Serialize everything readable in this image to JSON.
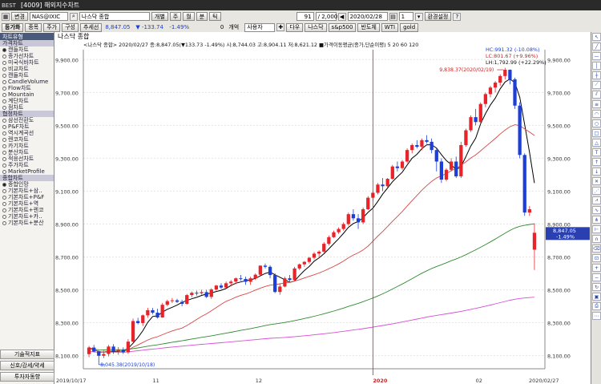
{
  "window": {
    "title": "[4009] 해외지수차트",
    "logo": "BEST"
  },
  "toolbar1": {
    "type": "변경",
    "code": "NAS@IXIC",
    "name": "나스닥 종합",
    "period": "개별",
    "tabs": [
      "주",
      "월",
      "분",
      "틱"
    ],
    "count_value": "91",
    "count_total": "2,000",
    "date": "2020/02/28",
    "lock": "1",
    "env": "환경설정"
  },
  "toolbar2": {
    "mode": "등가화",
    "buttons": [
      "종목",
      "주가",
      "구성",
      "추세선"
    ],
    "price": "8,847.05",
    "change": "▼ -133.74",
    "rate": "-1.49%",
    "qty": "0",
    "qty_label": "개억",
    "user": "사용자",
    "quick": [
      "다우",
      "나스닥",
      "s&p500",
      "반도체",
      "WTI",
      "gold"
    ]
  },
  "left_panel": {
    "header": "차트유형",
    "groups": [
      {
        "title": "가격차트",
        "items": [
          "캔들차트",
          "종가선차트",
          "미국식바차트",
          "비교차트",
          "캔들차트",
          "CandleVolume",
          "Flow차트",
          "Mountain",
          "계단차트",
          "점차트"
        ]
      },
      {
        "title": "협정차트",
        "items": [
          "삼선전환도",
          "P&F차트",
          "역시계곡선",
          "렌코차트",
          "카기차트",
          "분산차트",
          "적응선차트",
          "주가차트",
          "MarketProfile"
        ]
      },
      {
        "title": "종합차트",
        "items": [
          "종합인망",
          "기본차트+삼..",
          "기본차트+P&F",
          "기본차트+역",
          "기본차트+렌코",
          "기본차트+카..",
          "기본차트+분산"
        ]
      }
    ],
    "selected": "캔들차트",
    "bottom_buttons": [
      "기술적지표",
      "신호/강세/약세",
      "투자자동향"
    ]
  },
  "chart_caption": {
    "title": "나스닥 종합",
    "legend": "<나스닥 종합> 2020/02/27 종:8,847.05(▼133.73 -1.49%) 시:8,744.03 고:8,904.11 저:8,621.12 ■가격이동평균(종가,단순이평) 5 20 60 120"
  },
  "chart_data": {
    "type": "candlestick",
    "title": "나스닥 종합",
    "y_ticks": [
      "9,900.00",
      "9,700.00",
      "9,500.00",
      "9,300.00",
      "9,100.00",
      "8,900.00",
      "8,700.00",
      "8,500.00",
      "8,300.00",
      "8,100.00"
    ],
    "x_labels": [
      "2019/10/17",
      "11",
      "12",
      "2020",
      "02",
      "2020/02/27"
    ],
    "ylim": [
      8020,
      9960
    ],
    "annotations": {
      "high_label": "9,838.37(2020/02/19)",
      "low_label": "8,045.38(2019/10/18)",
      "hc": "HC:991.32 (-10.08%)",
      "lc": "LC:801.67 (+9.96%)",
      "lh": "LH:1,792.99 (+22.29%)"
    },
    "last_price": "8,847.05",
    "last_rate": "-1.49%",
    "ma_periods": [
      5,
      20,
      60,
      120
    ],
    "colors": {
      "up": "#e8242b",
      "down": "#1d3fd8",
      "ma5": "#000000",
      "ma20": "#d94545",
      "ma60": "#2f8a2f",
      "ma120": "#d64fd6",
      "grid": "#e6e6e6",
      "cursor": "#cc2020",
      "ycursor": "#2a3fb0"
    },
    "candles": [
      [
        8109,
        8159,
        8090,
        8149
      ],
      [
        8149,
        8165,
        8120,
        8125
      ],
      [
        8125,
        8130,
        8045,
        8099
      ],
      [
        8099,
        8130,
        8085,
        8110
      ],
      [
        8110,
        8165,
        8095,
        8155
      ],
      [
        8155,
        8170,
        8110,
        8125
      ],
      [
        8125,
        8152,
        8105,
        8135
      ],
      [
        8135,
        8150,
        8110,
        8120
      ],
      [
        8120,
        8200,
        8110,
        8185
      ],
      [
        8185,
        8325,
        8180,
        8310
      ],
      [
        8310,
        8330,
        8290,
        8298
      ],
      [
        8298,
        8350,
        8280,
        8345
      ],
      [
        8345,
        8390,
        8330,
        8376
      ],
      [
        8376,
        8390,
        8350,
        8361
      ],
      [
        8361,
        8385,
        8325,
        8332
      ],
      [
        8332,
        8420,
        8330,
        8409
      ],
      [
        8409,
        8440,
        8400,
        8431
      ],
      [
        8431,
        8450,
        8420,
        8436
      ],
      [
        8436,
        8445,
        8420,
        8427
      ],
      [
        8427,
        8440,
        8400,
        8415
      ],
      [
        8415,
        8475,
        8410,
        8468
      ],
      [
        8468,
        8490,
        8455,
        8482
      ],
      [
        8482,
        8495,
        8465,
        8479
      ],
      [
        8479,
        8500,
        8470,
        8486
      ],
      [
        8486,
        8500,
        8450,
        8457
      ],
      [
        8457,
        8510,
        8445,
        8502
      ],
      [
        8502,
        8530,
        8495,
        8526
      ],
      [
        8526,
        8540,
        8505,
        8514
      ],
      [
        8514,
        8550,
        8510,
        8540
      ],
      [
        8540,
        8560,
        8520,
        8550
      ],
      [
        8550,
        8575,
        8535,
        8570
      ],
      [
        8570,
        8590,
        8555,
        8566
      ],
      [
        8566,
        8580,
        8530,
        8549
      ],
      [
        8549,
        8580,
        8530,
        8570
      ],
      [
        8570,
        8600,
        8560,
        8592
      ],
      [
        8592,
        8650,
        8585,
        8647
      ],
      [
        8647,
        8660,
        8630,
        8640
      ],
      [
        8640,
        8650,
        8570,
        8590
      ],
      [
        8590,
        8600,
        8480,
        8487
      ],
      [
        8487,
        8535,
        8470,
        8520
      ],
      [
        8520,
        8580,
        8515,
        8570
      ],
      [
        8570,
        8590,
        8545,
        8560
      ],
      [
        8560,
        8640,
        8555,
        8630
      ],
      [
        8630,
        8660,
        8620,
        8655
      ],
      [
        8655,
        8675,
        8640,
        8670
      ],
      [
        8670,
        8700,
        8660,
        8695
      ],
      [
        8695,
        8730,
        8685,
        8720
      ],
      [
        8720,
        8740,
        8700,
        8732
      ],
      [
        8732,
        8790,
        8725,
        8780
      ],
      [
        8780,
        8830,
        8770,
        8820
      ],
      [
        8820,
        8860,
        8815,
        8850
      ],
      [
        8850,
        8880,
        8840,
        8870
      ],
      [
        8870,
        8910,
        8860,
        8900
      ],
      [
        8900,
        8970,
        8890,
        8960
      ],
      [
        8960,
        8990,
        8920,
        8935
      ],
      [
        8935,
        8960,
        8870,
        8910
      ],
      [
        8910,
        9000,
        8900,
        8990
      ],
      [
        8990,
        9070,
        8985,
        9060
      ],
      [
        9060,
        9100,
        9040,
        9090
      ],
      [
        9090,
        9150,
        9080,
        9140
      ],
      [
        9140,
        9180,
        9100,
        9130
      ],
      [
        9130,
        9180,
        9120,
        9175
      ],
      [
        9175,
        9260,
        9170,
        9250
      ],
      [
        9250,
        9280,
        9220,
        9240
      ],
      [
        9240,
        9290,
        9230,
        9280
      ],
      [
        9280,
        9360,
        9270,
        9350
      ],
      [
        9350,
        9390,
        9330,
        9380
      ],
      [
        9380,
        9410,
        9360,
        9370
      ],
      [
        9370,
        9420,
        9350,
        9410
      ],
      [
        9410,
        9440,
        9390,
        9400
      ],
      [
        9400,
        9420,
        9330,
        9350
      ],
      [
        9350,
        9360,
        9220,
        9280
      ],
      [
        9280,
        9300,
        9150,
        9170
      ],
      [
        9170,
        9240,
        9160,
        9230
      ],
      [
        9230,
        9300,
        9220,
        9280
      ],
      [
        9280,
        9310,
        9180,
        9190
      ],
      [
        9190,
        9400,
        9180,
        9380
      ],
      [
        9380,
        9480,
        9370,
        9470
      ],
      [
        9470,
        9560,
        9460,
        9550
      ],
      [
        9550,
        9600,
        9500,
        9520
      ],
      [
        9520,
        9640,
        9510,
        9630
      ],
      [
        9630,
        9700,
        9610,
        9690
      ],
      [
        9690,
        9740,
        9670,
        9730
      ],
      [
        9730,
        9770,
        9700,
        9760
      ],
      [
        9760,
        9810,
        9740,
        9800
      ],
      [
        9800,
        9850,
        9780,
        9838
      ],
      [
        9838,
        9840,
        9750,
        9780
      ],
      [
        9780,
        9790,
        9600,
        9620
      ],
      [
        9620,
        9640,
        9300,
        9320
      ],
      [
        9320,
        9330,
        8950,
        8970
      ],
      [
        8970,
        9010,
        8950,
        8990
      ],
      [
        8744,
        8904,
        8621,
        8847
      ]
    ]
  }
}
